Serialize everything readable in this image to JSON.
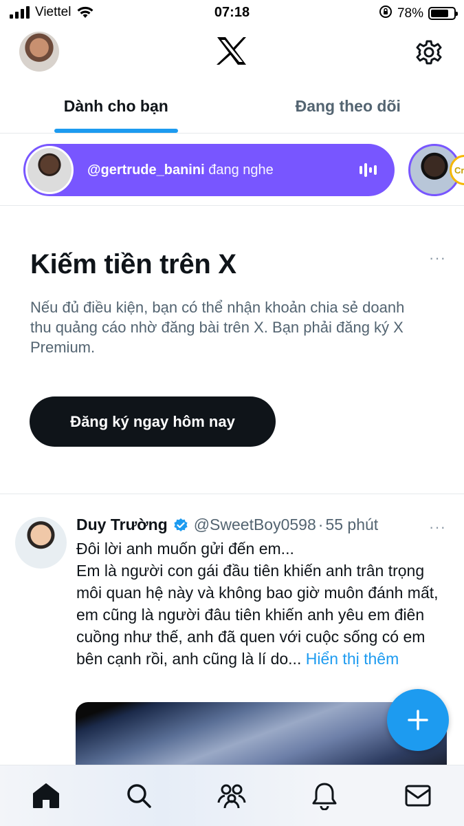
{
  "status_bar": {
    "carrier": "Viettel",
    "time": "07:18",
    "battery_percent": "78%",
    "battery_level": 0.78
  },
  "header": {
    "logo": "x-logo-icon",
    "settings_icon": "gear-icon"
  },
  "tabs": [
    {
      "label": "Dành cho bạn",
      "active": true
    },
    {
      "label": "Đang theo dõi",
      "active": false
    }
  ],
  "live_space": {
    "handle": "@gertrude_banini",
    "status": " đang nghe",
    "badge_text": "Cr"
  },
  "promo": {
    "title": "Kiếm tiền trên X",
    "description": "Nếu đủ điều kiện, bạn có thể nhận khoản chia sẻ doanh thu quảng cáo nhờ đăng bài trên X. Bạn phải đăng ký X Premium.",
    "button_label": "Đăng ký ngay hôm nay",
    "more_label": "···"
  },
  "tweet": {
    "name": "Duy Trường",
    "handle": "@SweetBoy0598",
    "separator": "·",
    "time": "55 phút",
    "more_label": "···",
    "text_line1": "Đôi lời anh muốn gửi đến em...",
    "text_body": "Em là người con gái đầu tiên khiến anh trân trọng môi quan hệ này và không bao giờ muôn đánh mất, em cũng là người đâu tiên khiến anh yêu em điên cuồng như thế, anh đã quen với cuộc sống có em bên cạnh rồi, anh cũng là lí do...",
    "show_more": "Hiển thị thêm"
  },
  "bottom_nav": {
    "items": [
      "home-icon",
      "search-icon",
      "communities-icon",
      "notifications-icon",
      "messages-icon"
    ]
  },
  "colors": {
    "accent": "#1d9bf0",
    "space_purple": "#7856ff",
    "text_primary": "#0f1419",
    "text_secondary": "#536471"
  }
}
